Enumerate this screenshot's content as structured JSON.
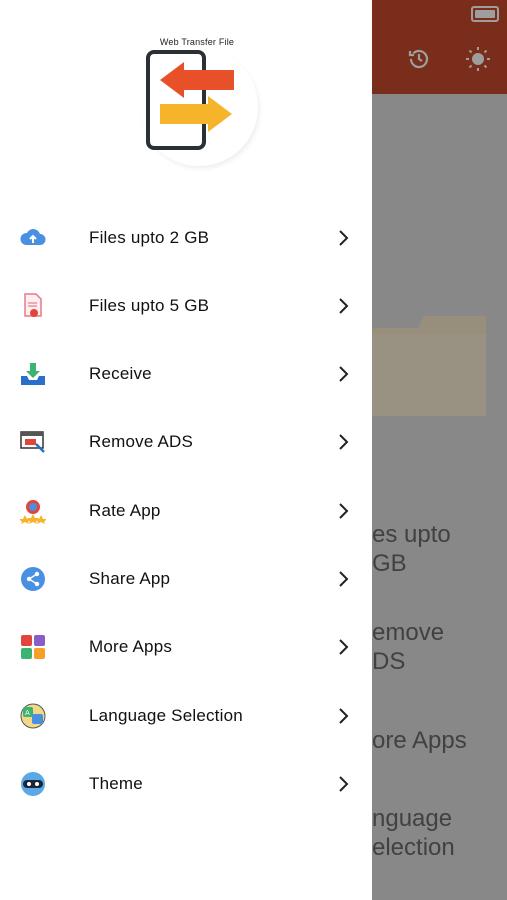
{
  "app": {
    "logo_text": "Web Transfer File"
  },
  "background": {
    "topbar_color": "#c44a2a",
    "icons": [
      "history-icon",
      "brightness-icon"
    ],
    "texts": [
      "es upto\nGB",
      "emove\nDS",
      "ore Apps",
      "nguage\nelection"
    ]
  },
  "drawer": {
    "items": [
      {
        "label": "Files upto 2 GB",
        "icon": "cloud-upload-icon"
      },
      {
        "label": "Files upto 5 GB",
        "icon": "file-upload-icon"
      },
      {
        "label": "Receive",
        "icon": "download-tray-icon"
      },
      {
        "label": "Remove ADS",
        "icon": "remove-ads-icon"
      },
      {
        "label": "Rate App",
        "icon": "rate-badge-icon"
      },
      {
        "label": "Share App",
        "icon": "share-icon"
      },
      {
        "label": "More Apps",
        "icon": "apps-grid-icon"
      },
      {
        "label": "Language Selection",
        "icon": "language-icon"
      },
      {
        "label": "Theme",
        "icon": "theme-mask-icon"
      }
    ]
  }
}
